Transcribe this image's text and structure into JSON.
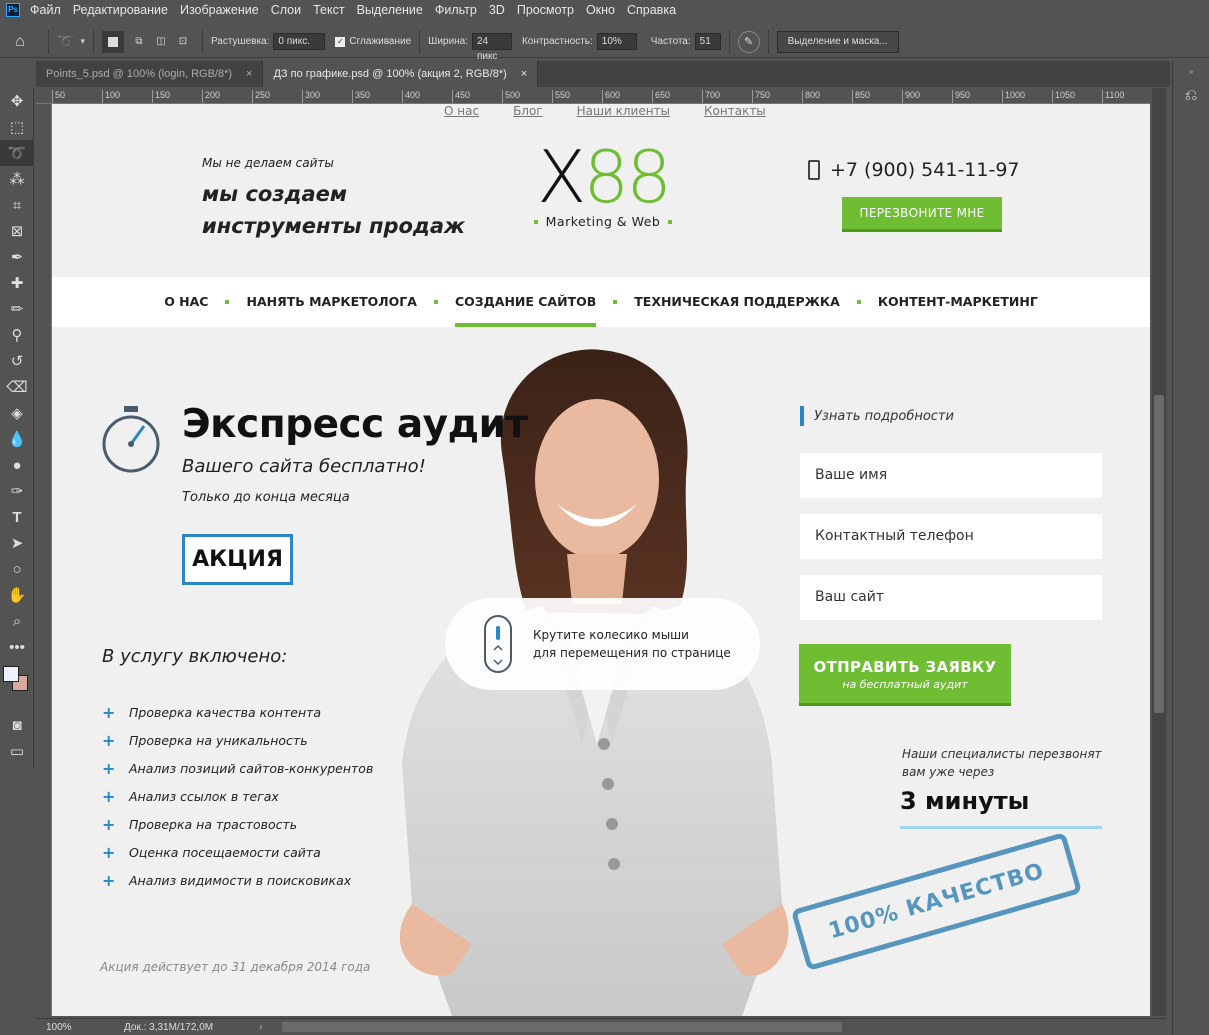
{
  "app": {
    "menu": [
      "Файл",
      "Редактирование",
      "Изображение",
      "Слои",
      "Текст",
      "Выделение",
      "Фильтр",
      "3D",
      "Просмотр",
      "Окно",
      "Справка"
    ],
    "logo": "Ps"
  },
  "options": {
    "feather_label": "Растушевка:",
    "feather_value": "0 пикс.",
    "antialias_label": "Сглаживание",
    "width_label": "Ширина:",
    "width_value": "24 пикс",
    "contrast_label": "Контрастность:",
    "contrast_value": "10%",
    "frequency_label": "Частота:",
    "frequency_value": "51",
    "select_mask_label": "Выделение и маска..."
  },
  "tabs": [
    {
      "label": "Points_5.psd @ 100% (login, RGB/8*)",
      "close": "×"
    },
    {
      "label": "ДЗ по графике.psd @ 100% (акция 2, RGB/8*)",
      "close": "×"
    }
  ],
  "ruler": [
    "50",
    "100",
    "150",
    "200",
    "250",
    "300",
    "350",
    "400",
    "450",
    "500",
    "550",
    "600",
    "650",
    "700",
    "750",
    "800",
    "850",
    "900",
    "950",
    "1000",
    "1050",
    "1100"
  ],
  "status": {
    "zoom": "100%",
    "doc": "Док.: 3,31M/172,0M"
  },
  "site": {
    "topnav": [
      "О нас",
      "Блог",
      "Наши клиенты",
      "Контакты"
    ],
    "tagline_small": "Мы не делаем сайты",
    "tagline_line1": "мы создаем",
    "tagline_line2": "инструменты продаж",
    "logo_x": "X",
    "logo_88": "88",
    "logo_sub": "Marketing & Web",
    "phone": "+7 (900) 541-11-97",
    "callback_button": "ПЕРЕЗВОНИТЕ МНЕ",
    "mainnav": [
      "О НАС",
      "НАНЯТЬ МАРКЕТОЛОГА",
      "СОЗДАНИЕ САЙТОВ",
      "ТЕХНИЧЕСКАЯ ПОДДЕРЖКА",
      "КОНТЕНТ-МАРКЕТИНГ"
    ],
    "hero_title": "Экспресс аудит",
    "hero_sub": "Вашего сайта бесплатно!",
    "hero_note": "Только до конца месяца",
    "akcia": "АКЦИЯ",
    "included_title": "В услугу включено:",
    "included": [
      "Проверка качества контента",
      "Проверка на уникальность",
      "Анализ позиций сайтов-конкурентов",
      "Анализ ссылок в тегах",
      "Проверка на трастовость",
      "Оценка посещаемости сайта",
      "Анализ видимости в поисковиках"
    ],
    "promo": "Акция действует до 31 декабря 2014 года",
    "scroll_hint_1": "Крутите колесико мыши",
    "scroll_hint_2": "для перемещения по странице",
    "form_head": "Узнать подробности",
    "field_name": "Ваше имя",
    "field_phone": "Контактный телефон",
    "field_site": "Ваш сайт",
    "send_main": "ОТПРАВИТЬ ЗАЯВКУ",
    "send_sub": "на бесплатный аудит",
    "callback_note_1": "Наши специалисты перезвонят",
    "callback_note_2": "вам уже через",
    "minutes": "3 минуты",
    "stamp": "100% КАЧЕСТВО"
  },
  "colors": {
    "green": "#6ebd33",
    "blue": "#2a87c6"
  }
}
